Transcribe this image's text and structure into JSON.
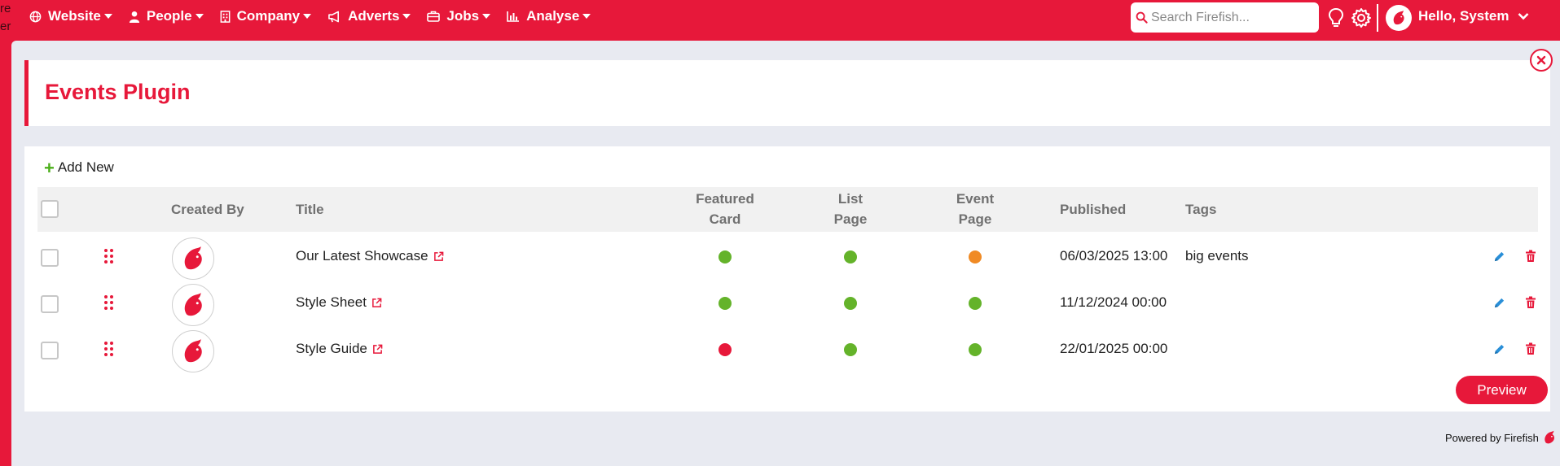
{
  "colors": {
    "brand": "#e7183a",
    "status_green": "#64b32a",
    "status_orange": "#f08a24",
    "status_red": "#e7183a"
  },
  "edge_text": [
    "re",
    "er"
  ],
  "nav": {
    "items": [
      {
        "label": "Website",
        "icon": "globe-icon"
      },
      {
        "label": "People",
        "icon": "user-icon"
      },
      {
        "label": "Company",
        "icon": "building-icon"
      },
      {
        "label": "Adverts",
        "icon": "megaphone-icon"
      },
      {
        "label": "Jobs",
        "icon": "briefcase-icon"
      },
      {
        "label": "Analyse",
        "icon": "bar-chart-icon"
      }
    ],
    "search_placeholder": "Search Firefish...",
    "greeting": "Hello, System"
  },
  "page": {
    "title": "Events Plugin",
    "add_new": "Add New",
    "preview": "Preview",
    "powered_by": "Powered by Firefish"
  },
  "table": {
    "headers": {
      "created_by": "Created By",
      "title": "Title",
      "featured_card_1": "Featured",
      "featured_card_2": "Card",
      "list_page_1": "List",
      "list_page_2": "Page",
      "event_page_1": "Event",
      "event_page_2": "Page",
      "published": "Published",
      "tags": "Tags"
    },
    "rows": [
      {
        "title": "Our Latest Showcase",
        "featured_card": "green",
        "list_page": "green",
        "event_page": "orange",
        "published": "06/03/2025 13:00",
        "tags": "big events"
      },
      {
        "title": "Style Sheet",
        "featured_card": "green",
        "list_page": "green",
        "event_page": "green",
        "published": "11/12/2024 00:00",
        "tags": ""
      },
      {
        "title": "Style Guide",
        "featured_card": "red",
        "list_page": "green",
        "event_page": "green",
        "published": "22/01/2025 00:00",
        "tags": ""
      }
    ]
  }
}
